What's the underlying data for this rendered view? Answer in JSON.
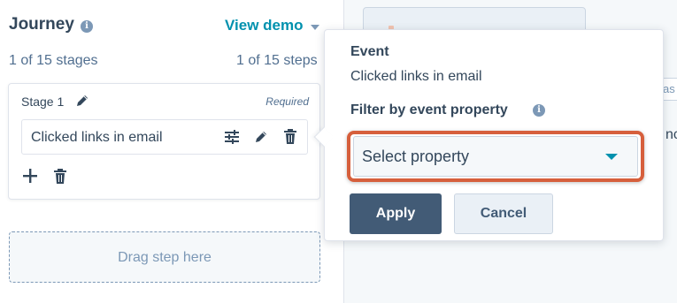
{
  "header": {
    "title": "Journey",
    "view_demo_label": "View demo"
  },
  "counts": {
    "stages": "1 of 15 stages",
    "steps": "1 of 15 steps"
  },
  "stage": {
    "label": "Stage 1",
    "required_label": "Required",
    "step_label": "Clicked links in email"
  },
  "drop_zone": {
    "label": "Drag step here"
  },
  "popover": {
    "event_heading": "Event",
    "event_value": "Clicked links in email",
    "filter_heading": "Filter by event property",
    "select_placeholder": "Select property",
    "apply_label": "Apply",
    "cancel_label": "Cancel"
  },
  "background": {
    "tab_fragment": "as",
    "text_fragment": "nc"
  },
  "colors": {
    "accent": "#0091ae",
    "primary_button": "#425b76",
    "highlight": "#d65f3c",
    "text": "#33475b"
  }
}
